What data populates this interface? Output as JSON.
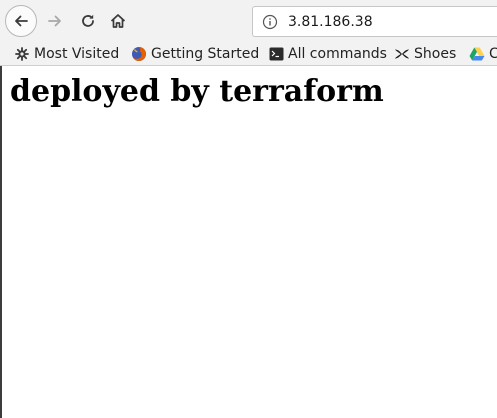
{
  "browser": {
    "url": "3.81.186.38",
    "nav_icons": [
      "back-arrow-icon",
      "forward-arrow-icon",
      "reload-icon",
      "home-icon",
      "info-icon"
    ]
  },
  "bookmarks": {
    "most_visited": "Most Visited",
    "getting_started": "Getting Started",
    "all_commands": "All commands",
    "shoes": "Shoes",
    "truncated": "C"
  },
  "page": {
    "heading": "deployed by terraform"
  },
  "colors": {
    "chrome_bg": "#f2f2f2",
    "firefox_orange": "#e66000",
    "firefox_blue": "#3d5bb5",
    "drive_green": "#1fa463",
    "drive_yellow": "#ffd04b",
    "drive_blue": "#4688f4"
  }
}
